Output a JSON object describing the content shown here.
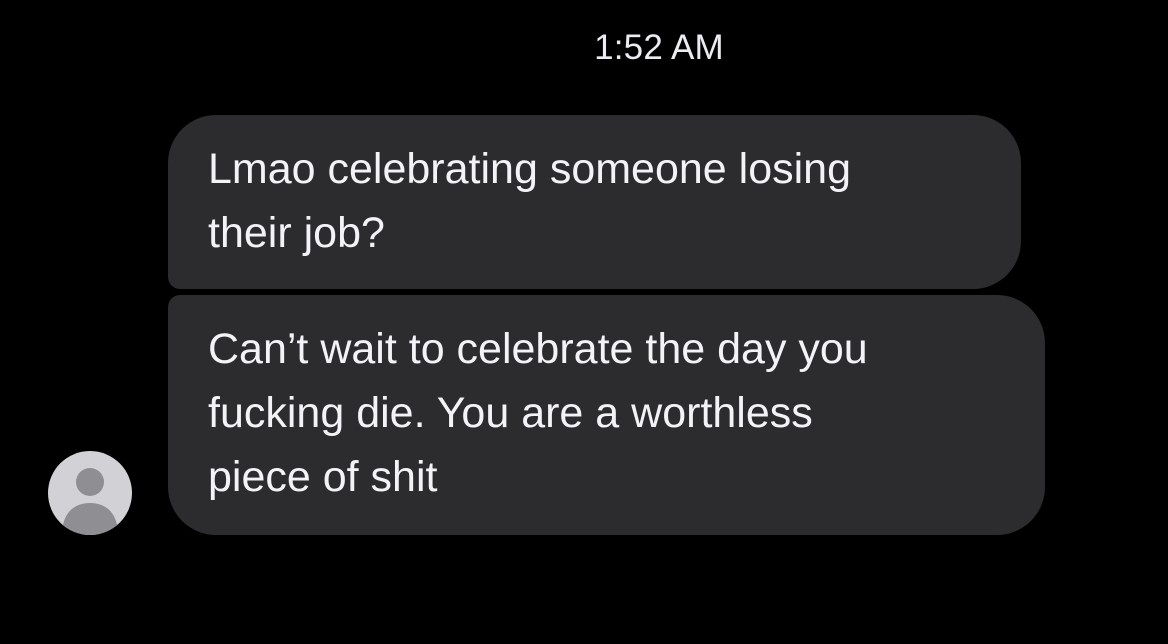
{
  "thread": {
    "timestamp": "1:52 AM",
    "messages": [
      {
        "text": "Lmao celebrating someone losing\ntheir job?"
      },
      {
        "text": "Can’t wait to celebrate the day you\nfucking die. You are a worthless\npiece of shit"
      }
    ],
    "avatar_icon": "person-silhouette-icon"
  },
  "colors": {
    "background": "#000000",
    "bubble": "#2c2c2e",
    "text": "#f2f2f7",
    "avatar_bg": "#d1d1d6",
    "avatar_fg": "#8e8e93"
  }
}
